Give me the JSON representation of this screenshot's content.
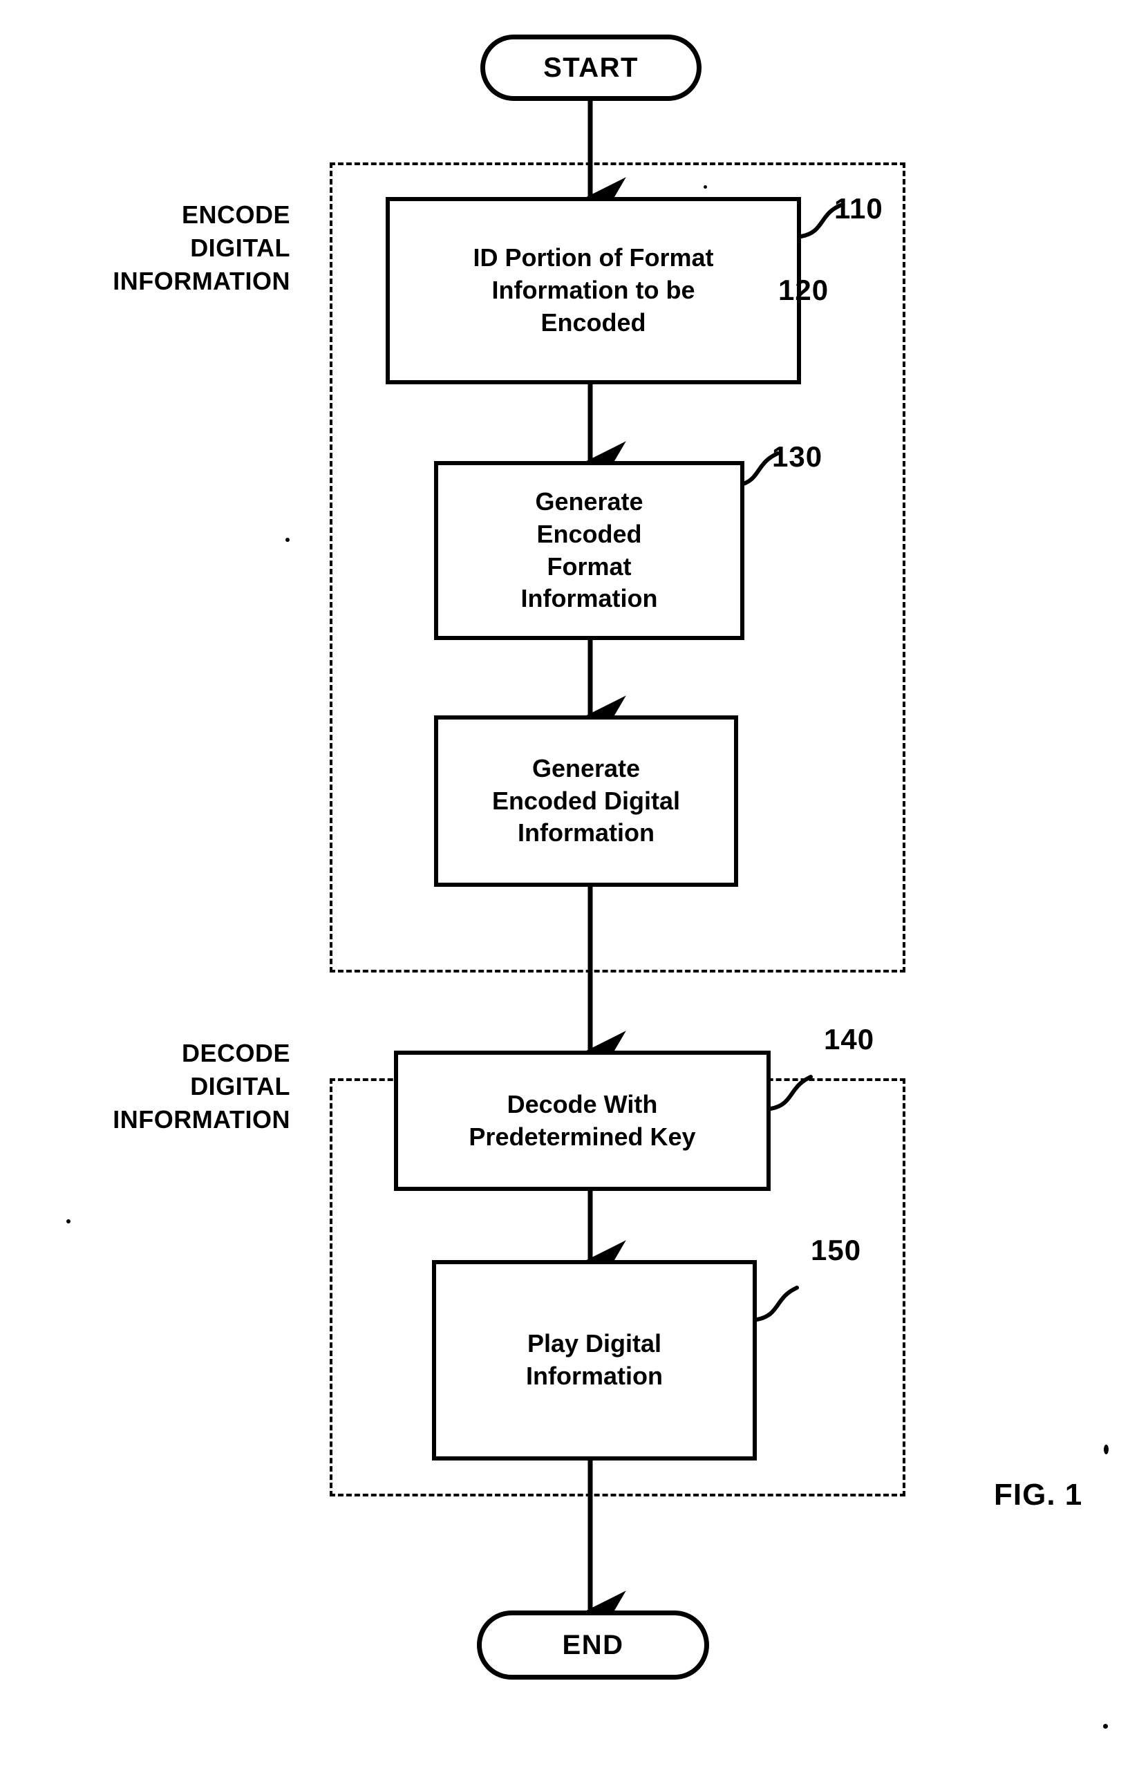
{
  "figure": {
    "caption": "FIG. 1",
    "type": "flowchart"
  },
  "terminators": {
    "start": {
      "label": "START"
    },
    "end": {
      "label": "END"
    }
  },
  "sections": [
    {
      "id": "encode",
      "caption": "ENCODE\nDIGITAL\nINFORMATION"
    },
    {
      "id": "decode",
      "caption": "DECODE\nDIGITAL\nINFORMATION"
    }
  ],
  "steps": [
    {
      "ref": "110",
      "text": "ID Portion of Format\nInformation to be\nEncoded",
      "section": "encode"
    },
    {
      "ref": "120",
      "text": "Generate\nEncoded\nFormat\nInformation",
      "section": "encode"
    },
    {
      "ref": "130",
      "text": "Generate\nEncoded Digital\nInformation",
      "section": "encode"
    },
    {
      "ref": "140",
      "text": "Decode With\nPredetermined Key",
      "section": "decode"
    },
    {
      "ref": "150",
      "text": "Play Digital\nInformation",
      "section": "decode"
    }
  ],
  "colors": {
    "ink": "#000000",
    "paper": "#ffffff"
  }
}
